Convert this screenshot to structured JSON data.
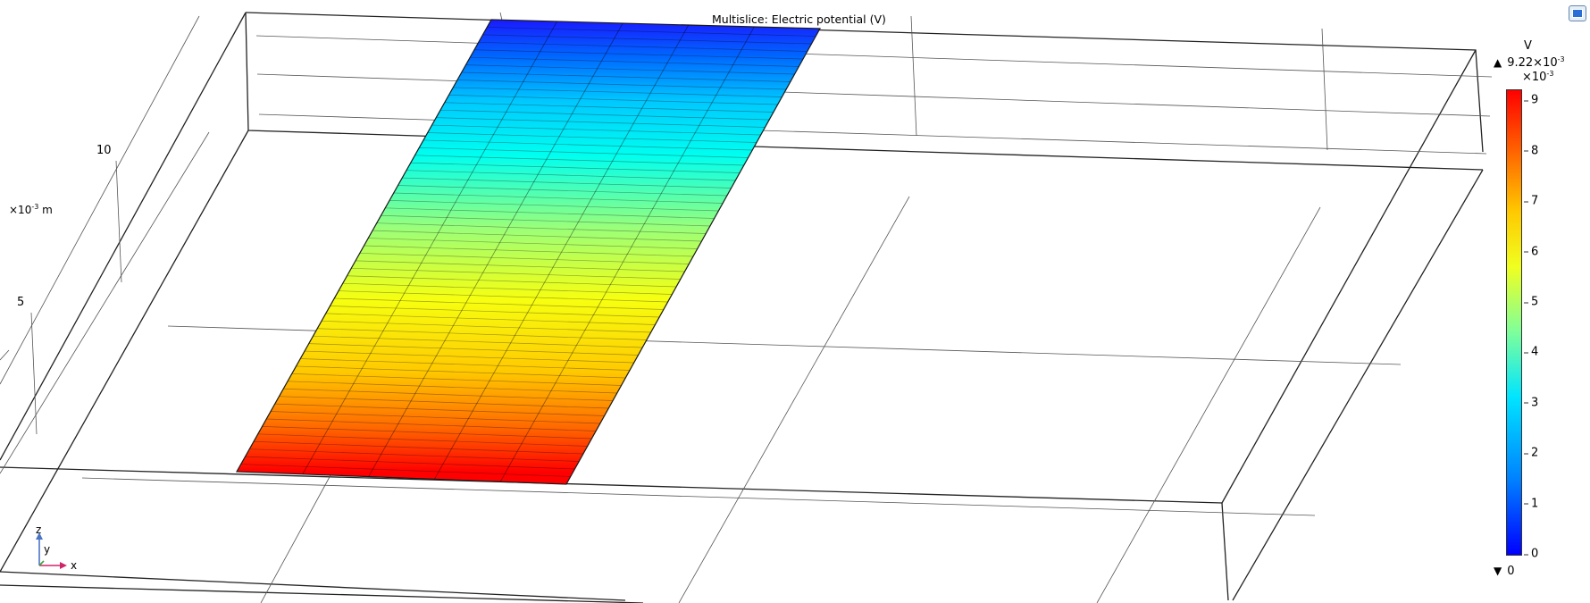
{
  "plot": {
    "title": "Multislice: Electric potential (V)"
  },
  "axis": {
    "tick_10": "10",
    "tick_5": "5",
    "scale_prefix": "×10",
    "scale_exp": "-3",
    "scale_unit": " m"
  },
  "colorbar": {
    "unit": "V",
    "max_symbol": "▲",
    "max_value_prefix": "9.22×10",
    "max_exp": "-3",
    "scale_prefix": "×10",
    "scale_exp": "-3",
    "min_symbol": "▼",
    "min_value": "0",
    "ticks": [
      {
        "label": "9",
        "value": 9
      },
      {
        "label": "8",
        "value": 8
      },
      {
        "label": "7",
        "value": 7
      },
      {
        "label": "6",
        "value": 6
      },
      {
        "label": "5",
        "value": 5
      },
      {
        "label": "4",
        "value": 4
      },
      {
        "label": "3",
        "value": 3
      },
      {
        "label": "2",
        "value": 2
      },
      {
        "label": "1",
        "value": 1
      },
      {
        "label": "0",
        "value": 0
      }
    ],
    "range_max": 9.22,
    "colors": {
      "min": "#0000ff",
      "mid": "#f0ff20",
      "max": "#ff0000"
    }
  },
  "triad": {
    "z": "z",
    "y": "y",
    "x": "x",
    "colors": {
      "x": "#d0246a",
      "y": "#3aa635",
      "z": "#4a74c4"
    }
  },
  "toolbar": {
    "view_toggle_icon": "graphics-window-icon"
  }
}
